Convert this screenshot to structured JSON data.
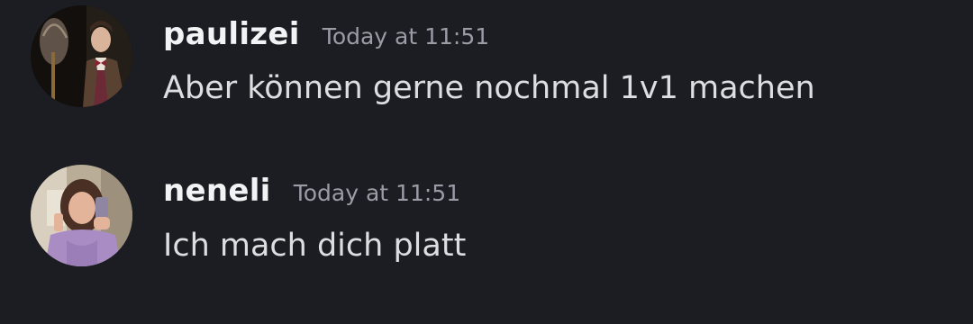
{
  "messages": [
    {
      "username": "paulizei",
      "timestamp": "Today at 11:51",
      "content": "Aber können gerne nochmal 1v1 machen",
      "avatar_icon": "user-avatar-man-in-bowtie"
    },
    {
      "username": "neneli",
      "timestamp": "Today at 11:51",
      "content": "Ich mach dich platt",
      "avatar_icon": "user-avatar-woman-selfie"
    }
  ],
  "colors": {
    "background": "#1c1d22",
    "username": "#f2f3f5",
    "timestamp": "#9a9ca6",
    "message_text": "#dcdee2"
  }
}
